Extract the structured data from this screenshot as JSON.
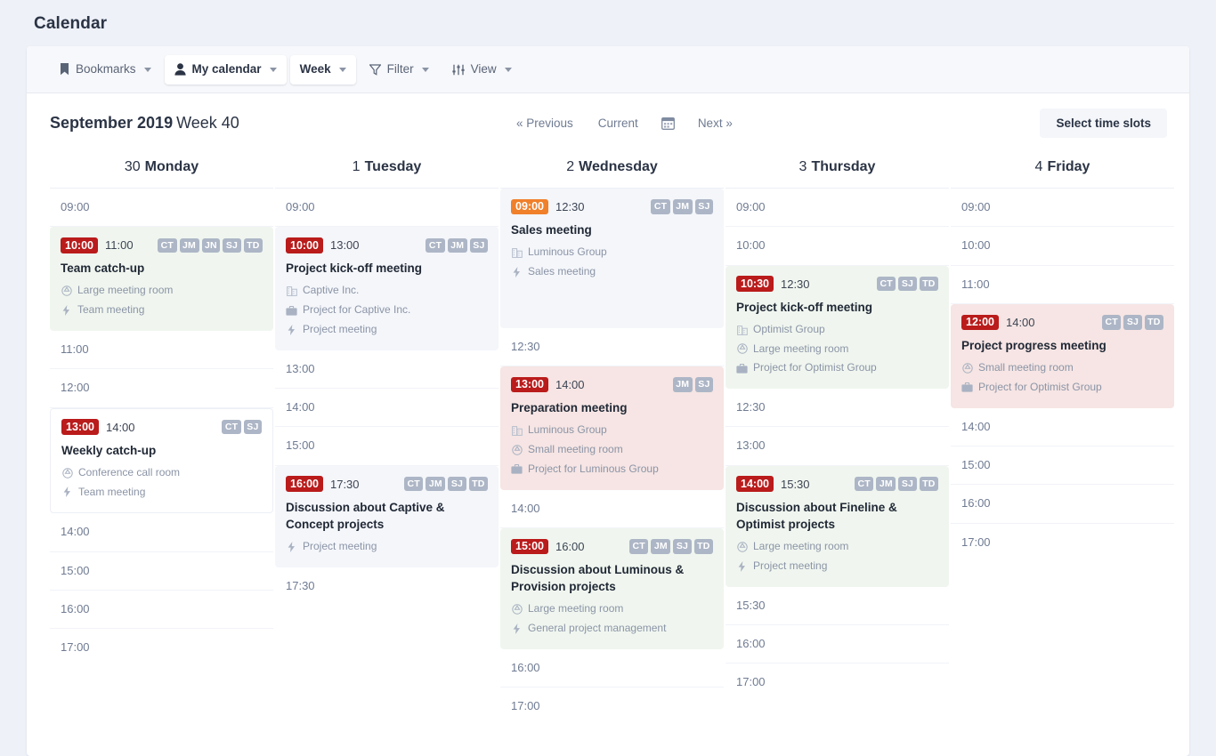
{
  "page": {
    "title": "Calendar"
  },
  "toolbar": {
    "bookmarks_label": "Bookmarks",
    "calendar_label": "My calendar",
    "period_label": "Week",
    "filter_label": "Filter",
    "view_label": "View"
  },
  "weekbar": {
    "month_year": "September 2019",
    "week_label": "Week 40",
    "previous_label": "« Previous",
    "current_label": "Current",
    "next_label": "Next »",
    "select_slots_label": "Select time slots"
  },
  "colors": {
    "accent_red": "#ba1b1b",
    "accent_orange": "#f0802a",
    "avatar_bg": "#adb6c6",
    "card_green": "#f0f6ef",
    "card_rose": "#f6e5e4",
    "card_slate": "#f4f6fa",
    "page_bg": "#eef1f8"
  },
  "days": [
    {
      "number": "30",
      "name": "Monday",
      "rows": [
        {
          "kind": "slot",
          "label": "09:00"
        },
        {
          "kind": "event",
          "tone": "green",
          "start": "10:00",
          "start_tone": "red",
          "end": "11:00",
          "attendees": [
            "CT",
            "JM",
            "JN",
            "SJ",
            "TD"
          ],
          "title": "Team catch-up",
          "meta": [
            {
              "icon": "room-icon",
              "text": "Large meeting room"
            },
            {
              "icon": "bolt-icon",
              "text": "Team meeting"
            }
          ]
        },
        {
          "kind": "slot",
          "label": "11:00"
        },
        {
          "kind": "slot",
          "label": "12:00"
        },
        {
          "kind": "event",
          "tone": "plain",
          "start": "13:00",
          "start_tone": "red",
          "end": "14:00",
          "attendees": [
            "CT",
            "SJ"
          ],
          "title": "Weekly catch-up",
          "meta": [
            {
              "icon": "room-icon",
              "text": "Conference call room"
            },
            {
              "icon": "bolt-icon",
              "text": "Team meeting"
            }
          ]
        },
        {
          "kind": "slot",
          "label": "14:00"
        },
        {
          "kind": "slot",
          "label": "15:00"
        },
        {
          "kind": "slot",
          "label": "16:00"
        },
        {
          "kind": "slot",
          "label": "17:00",
          "last": true
        }
      ]
    },
    {
      "number": "1",
      "name": "Tuesday",
      "rows": [
        {
          "kind": "slot",
          "label": "09:00"
        },
        {
          "kind": "event",
          "tone": "slate",
          "start": "10:00",
          "start_tone": "red",
          "end": "13:00",
          "attendees": [
            "CT",
            "JM",
            "SJ"
          ],
          "title": "Project kick-off meeting",
          "meta": [
            {
              "icon": "company-icon",
              "text": "Captive Inc."
            },
            {
              "icon": "briefcase-icon",
              "text": "Project for Captive Inc."
            },
            {
              "icon": "bolt-icon",
              "text": "Project meeting"
            }
          ]
        },
        {
          "kind": "slot",
          "label": "13:00"
        },
        {
          "kind": "slot",
          "label": "14:00"
        },
        {
          "kind": "slot",
          "label": "15:00"
        },
        {
          "kind": "event",
          "tone": "slate",
          "start": "16:00",
          "start_tone": "red",
          "end": "17:30",
          "attendees": [
            "CT",
            "JM",
            "SJ",
            "TD"
          ],
          "title": "Discussion about Captive & Concept projects",
          "meta": [
            {
              "icon": "bolt-icon",
              "text": "Project meeting"
            }
          ]
        },
        {
          "kind": "slot",
          "label": "17:30",
          "last": true
        }
      ]
    },
    {
      "number": "2",
      "name": "Wednesday",
      "rows": [
        {
          "kind": "event",
          "tone": "slate",
          "start": "09:00",
          "start_tone": "orange",
          "end": "12:30",
          "attendees": [
            "CT",
            "JM",
            "SJ"
          ],
          "title": "Sales meeting",
          "meta": [
            {
              "icon": "company-icon",
              "text": "Luminous Group"
            },
            {
              "icon": "bolt-icon",
              "text": "Sales meeting"
            }
          ],
          "pad_bottom": 52
        },
        {
          "kind": "slot",
          "label": "12:30"
        },
        {
          "kind": "event",
          "tone": "rose",
          "start": "13:00",
          "start_tone": "red",
          "end": "14:00",
          "attendees": [
            "JM",
            "SJ"
          ],
          "title": "Preparation meeting",
          "meta": [
            {
              "icon": "company-icon",
              "text": "Luminous Group"
            },
            {
              "icon": "room-icon",
              "text": "Small meeting room"
            },
            {
              "icon": "briefcase-icon",
              "text": "Project for Luminous Group"
            }
          ]
        },
        {
          "kind": "slot",
          "label": "14:00"
        },
        {
          "kind": "event",
          "tone": "green",
          "start": "15:00",
          "start_tone": "red",
          "end": "16:00",
          "attendees": [
            "CT",
            "JM",
            "SJ",
            "TD"
          ],
          "title": "Discussion about Luminous & Provision projects",
          "meta": [
            {
              "icon": "room-icon",
              "text": "Large meeting room"
            },
            {
              "icon": "bolt-icon",
              "text": "General project management"
            }
          ]
        },
        {
          "kind": "slot",
          "label": "16:00"
        },
        {
          "kind": "slot",
          "label": "17:00",
          "last": true
        }
      ]
    },
    {
      "number": "3",
      "name": "Thursday",
      "rows": [
        {
          "kind": "slot",
          "label": "09:00"
        },
        {
          "kind": "slot",
          "label": "10:00"
        },
        {
          "kind": "event",
          "tone": "green",
          "start": "10:30",
          "start_tone": "red",
          "end": "12:30",
          "attendees": [
            "CT",
            "SJ",
            "TD"
          ],
          "title": "Project kick-off meeting",
          "meta": [
            {
              "icon": "company-icon",
              "text": "Optimist Group"
            },
            {
              "icon": "room-icon",
              "text": "Large meeting room"
            },
            {
              "icon": "briefcase-icon",
              "text": "Project for Optimist Group"
            }
          ]
        },
        {
          "kind": "slot",
          "label": "12:30"
        },
        {
          "kind": "slot",
          "label": "13:00"
        },
        {
          "kind": "event",
          "tone": "green",
          "start": "14:00",
          "start_tone": "red",
          "end": "15:30",
          "attendees": [
            "CT",
            "JM",
            "SJ",
            "TD"
          ],
          "title": "Discussion about Fineline & Optimist projects",
          "meta": [
            {
              "icon": "room-icon",
              "text": "Large meeting room"
            },
            {
              "icon": "bolt-icon",
              "text": "Project meeting"
            }
          ]
        },
        {
          "kind": "slot",
          "label": "15:30"
        },
        {
          "kind": "slot",
          "label": "16:00"
        },
        {
          "kind": "slot",
          "label": "17:00",
          "last": true
        }
      ]
    },
    {
      "number": "4",
      "name": "Friday",
      "rows": [
        {
          "kind": "slot",
          "label": "09:00"
        },
        {
          "kind": "slot",
          "label": "10:00"
        },
        {
          "kind": "slot",
          "label": "11:00"
        },
        {
          "kind": "event",
          "tone": "rose",
          "start": "12:00",
          "start_tone": "red",
          "end": "14:00",
          "attendees": [
            "CT",
            "SJ",
            "TD"
          ],
          "title": "Project progress meeting",
          "meta": [
            {
              "icon": "room-icon",
              "text": "Small meeting room"
            },
            {
              "icon": "briefcase-icon",
              "text": "Project for Optimist Group"
            }
          ]
        },
        {
          "kind": "slot",
          "label": "14:00"
        },
        {
          "kind": "slot",
          "label": "15:00"
        },
        {
          "kind": "slot",
          "label": "16:00"
        },
        {
          "kind": "slot",
          "label": "17:00",
          "last": true
        }
      ]
    }
  ]
}
